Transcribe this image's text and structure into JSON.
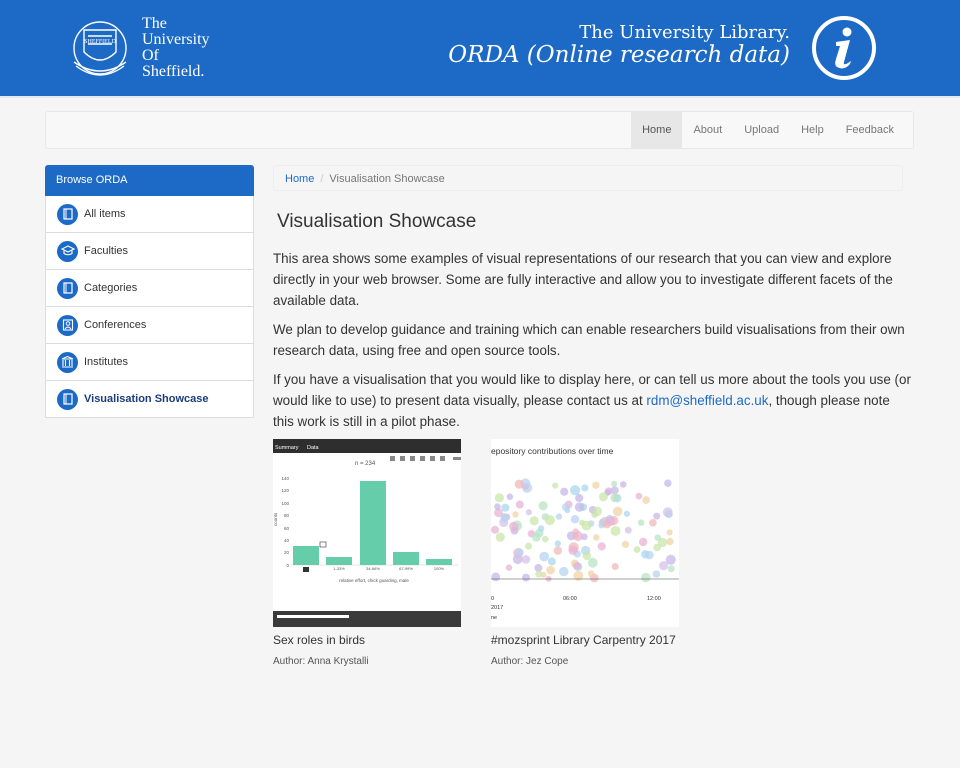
{
  "header": {
    "logo_text": [
      "The",
      "University",
      "Of",
      "Sheffield."
    ],
    "library_title": "The University Library.",
    "library_subtitle": "ORDA (Online research data)",
    "brand_color": "#1d6ac6"
  },
  "nav": {
    "items": [
      {
        "label": "Home",
        "active": true
      },
      {
        "label": "About"
      },
      {
        "label": "Upload"
      },
      {
        "label": "Help"
      },
      {
        "label": "Feedback"
      }
    ]
  },
  "sidebar": {
    "heading": "Browse ORDA",
    "items": [
      {
        "label": "All items",
        "icon": "book-icon"
      },
      {
        "label": "Faculties",
        "icon": "graduation-cap-icon"
      },
      {
        "label": "Categories",
        "icon": "book-icon"
      },
      {
        "label": "Conferences",
        "icon": "person-icon"
      },
      {
        "label": "Institutes",
        "icon": "building-icon"
      },
      {
        "label": "Visualisation Showcase",
        "icon": "book-icon",
        "active": true
      }
    ]
  },
  "breadcrumb": {
    "home": "Home",
    "current": "Visualisation Showcase"
  },
  "main": {
    "title": "Visualisation Showcase",
    "para1": "This area shows some examples of visual representations of our research that you can view and explore directly in your web browser. Some are fully interactive and allow you to investigate different facets of the available data.",
    "para2": "We plan to develop guidance and training which can enable researchers build visualisations from their own research data, using free and open source tools.",
    "para3_before": "If you have a visualisation that you would like to display here, or can tell us more about the tools you use (or would like to use) to present data visually, please contact us at ",
    "para3_link": "rdm@sheffield.ac.uk",
    "para3_after": ", though please note this work is still in a pilot phase."
  },
  "showcase": [
    {
      "title": "Sex roles in birds",
      "author": "Author: Anna Krystalli",
      "thumb": {
        "tab1": "Summary",
        "tab2": "Data",
        "n_label": "n = 234",
        "y_label": "counts",
        "x_label": "relative effort, chick guarding, male",
        "y_ticks": [
          "140",
          "120",
          "100",
          "80",
          "60",
          "40",
          "20",
          "0"
        ],
        "x_ticks": [
          "1-33%",
          "34-66%",
          "67-99%",
          "100%"
        ]
      }
    },
    {
      "title": "#mozsprint Library Carpentry 2017",
      "author": "Author: Jez Cope",
      "thumb": {
        "title": "epository contributions over time",
        "x_ticks": [
          "0",
          "06:00",
          "12:00"
        ],
        "x_sub": [
          "2017",
          "ne"
        ]
      }
    }
  ]
}
